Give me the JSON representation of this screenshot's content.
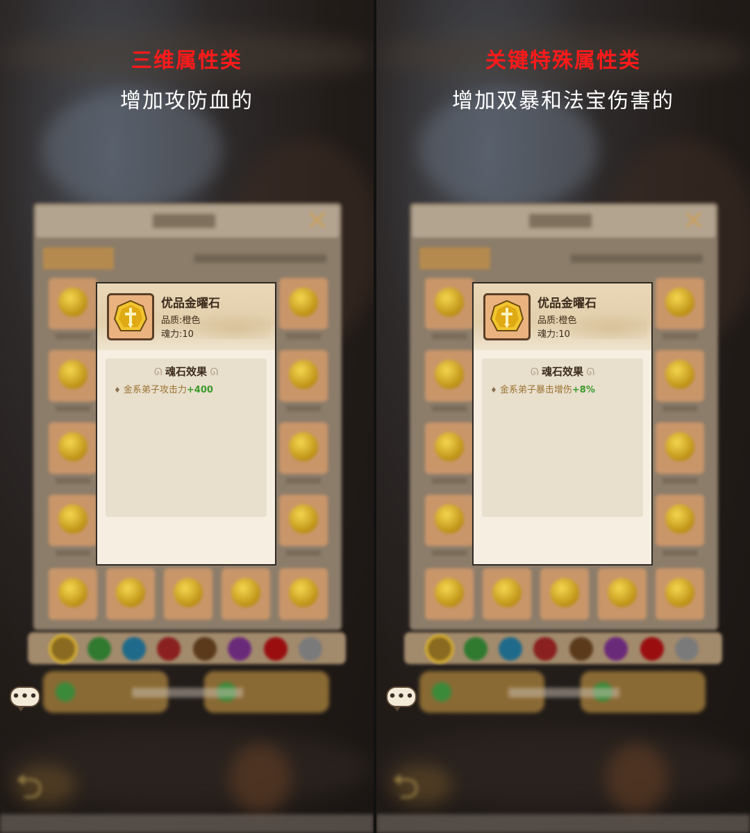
{
  "panels": [
    {
      "caption_title": "三维属性类",
      "caption_subtitle": "增加攻防血的",
      "tooltip": {
        "item_name": "优品金曜石",
        "quality_line": "品质:橙色",
        "soul_line": "魂力:10",
        "effect_title": "魂石效果",
        "effect_label": "金系弟子攻击力",
        "effect_value": "+400"
      }
    },
    {
      "caption_title": "关键特殊属性类",
      "caption_subtitle": "增加双暴和法宝伤害的",
      "tooltip": {
        "item_name": "优品金曜石",
        "quality_line": "品质:橙色",
        "soul_line": "魂力:10",
        "effect_title": "魂石效果",
        "effect_label": "金系弟子暴击增伤",
        "effect_value": "+8%"
      }
    }
  ],
  "colors": {
    "caption_title": "#ff1a1a",
    "effect_value": "#3a9a2a",
    "effect_label": "#9a7230"
  },
  "icons": {
    "item": "gold-sword-gem-icon",
    "chat": "chat-bubble-icon",
    "close": "close-x-icon",
    "back": "back-arrow-icon"
  }
}
